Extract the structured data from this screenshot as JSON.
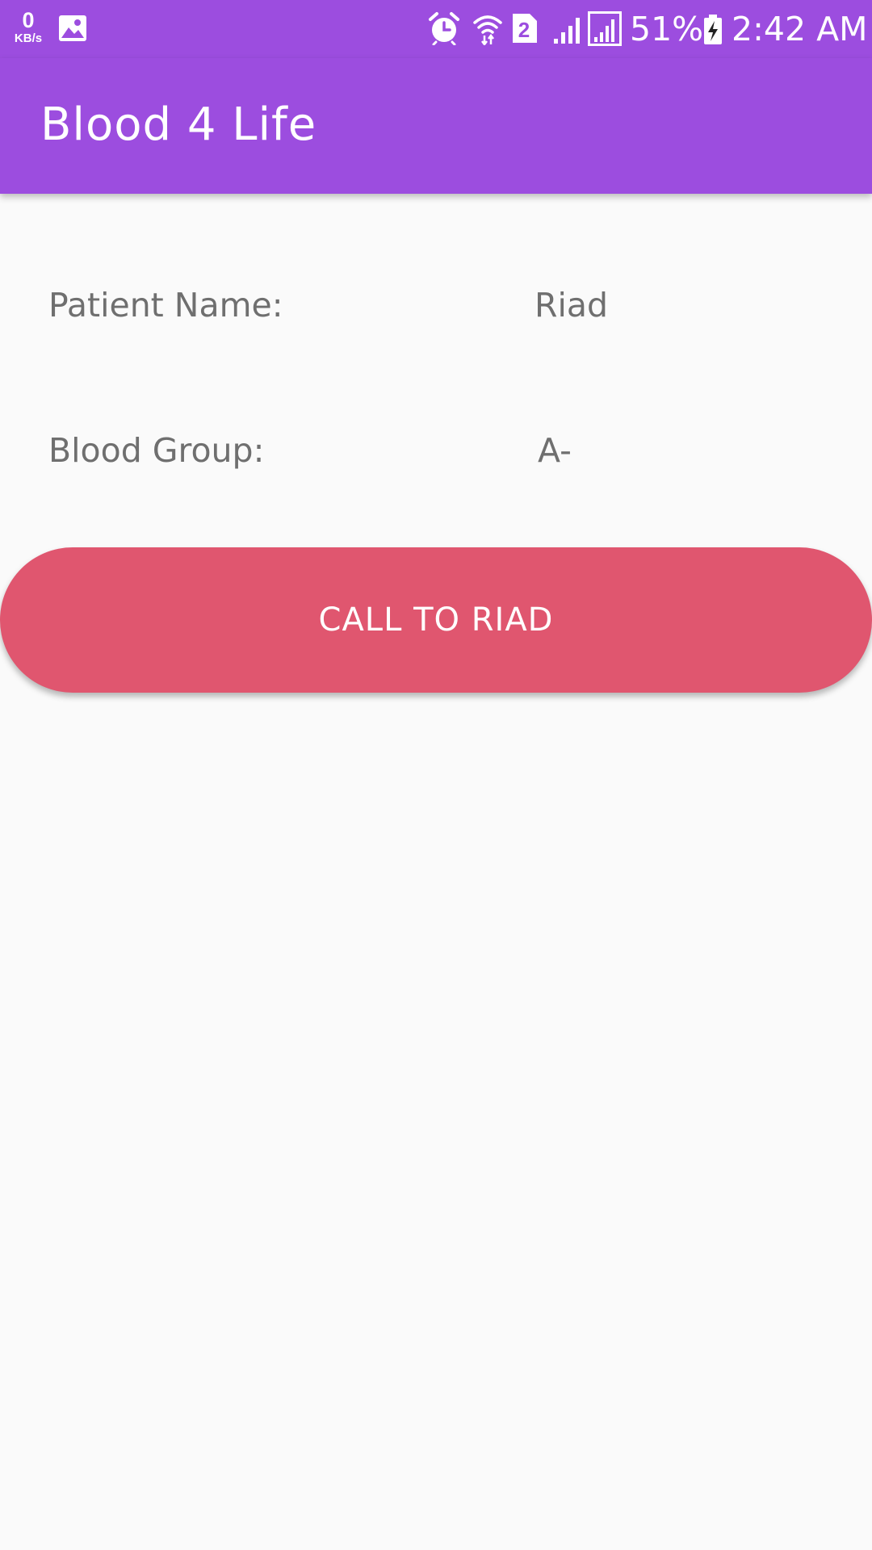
{
  "status_bar": {
    "net_speed_value": "0",
    "net_speed_unit": "KB/s",
    "sim_slot": "2",
    "battery_percent": "51%",
    "time": "2:42 AM",
    "icons": [
      "gallery-icon",
      "alarm-icon",
      "wifi-icon",
      "sim-2-icon",
      "signal-icon",
      "signal-full-icon",
      "battery-charging-icon"
    ]
  },
  "app_bar": {
    "title": "Blood 4 Life"
  },
  "details": {
    "patient_name_label": "Patient Name:",
    "patient_name_value": "Riad",
    "blood_group_label": "Blood Group:",
    "blood_group_value": "A-"
  },
  "actions": {
    "call_label": "CALL TO RIAD"
  },
  "colors": {
    "primary": "#9c4ddf",
    "accent_button": "#e0566f",
    "background": "#fafafa",
    "text_secondary": "#6f6f6f"
  }
}
